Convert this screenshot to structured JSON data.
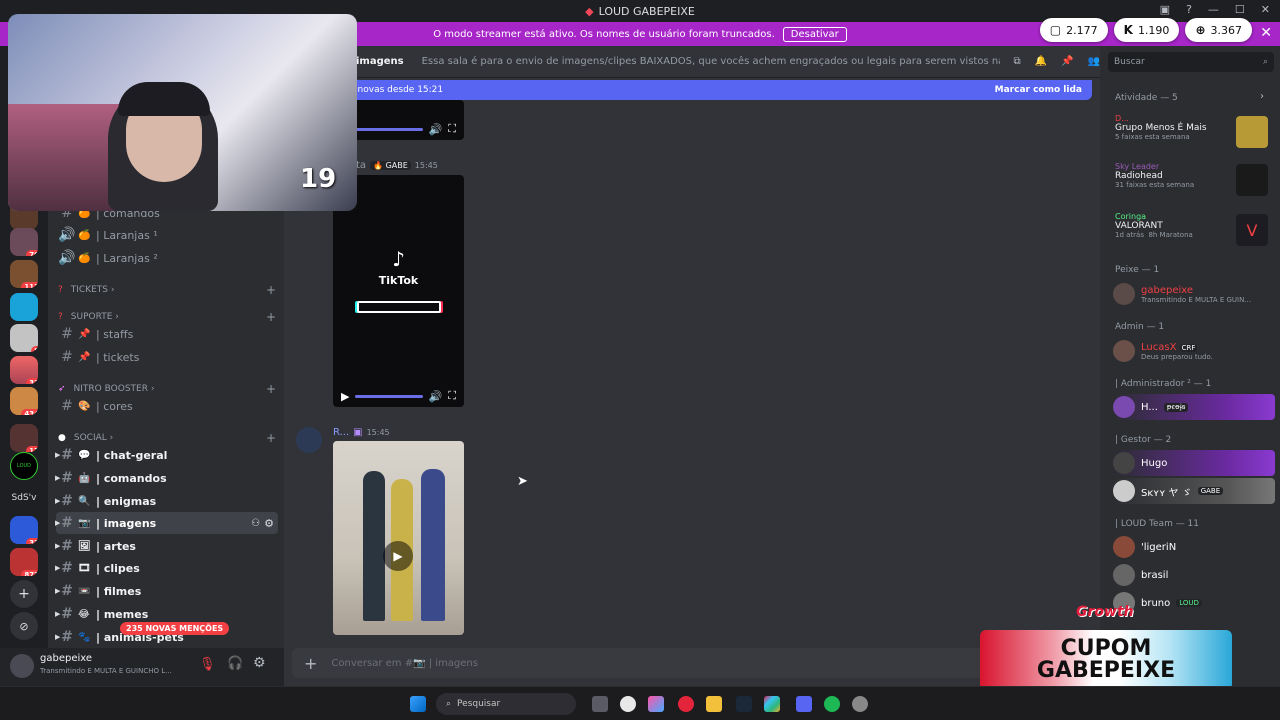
{
  "window": {
    "title": "LOUD GABEPEIXE"
  },
  "banner": {
    "text": "O modo streamer está ativo. Os nomes de usuário foram truncados.",
    "button": "Desativar"
  },
  "pills": [
    {
      "icon": "chat-bubble-icon",
      "value": "2.177"
    },
    {
      "icon": "kick-icon",
      "value": "1.190"
    },
    {
      "icon": "globe-icon",
      "value": "3.367"
    }
  ],
  "webcam": {
    "overlay_number": "19"
  },
  "guild_badges": [
    "70",
    "113",
    "8",
    "32",
    "434",
    "17",
    "32",
    "872"
  ],
  "guild_text": {
    "sdsv": "SdS'v",
    "loud": "LOUD"
  },
  "sidebar": {
    "top_channels": [
      {
        "label": "| comandos",
        "emoji": "🍊",
        "icon": "hash"
      },
      {
        "label": "| Laranjas ¹",
        "emoji": "🍊",
        "icon": "speaker"
      },
      {
        "label": "| Laranjas ²",
        "emoji": "🍊",
        "icon": "speaker"
      }
    ],
    "categories": {
      "tickets": "TICKETS",
      "suporte": "SUPORTE",
      "nitro": "NITRO BOOSTER",
      "social": "SOCIAL"
    },
    "suporte_channels": [
      {
        "label": "| staffs",
        "emoji": "📌"
      },
      {
        "label": "| tickets",
        "emoji": "📌"
      }
    ],
    "nitro_channels": [
      {
        "label": "| cores",
        "emoji": "🎨"
      }
    ],
    "social_channels": [
      {
        "label": "| chat-geral",
        "emoji": "💬"
      },
      {
        "label": "| comandos",
        "emoji": "🤖"
      },
      {
        "label": "| enigmas",
        "emoji": "🔍"
      },
      {
        "label": "| imagens",
        "emoji": "📷"
      },
      {
        "label": "| artes",
        "emoji": "🖼"
      },
      {
        "label": "| clipes",
        "emoji": "🎞"
      },
      {
        "label": "| filmes",
        "emoji": "📼"
      },
      {
        "label": "| memes",
        "emoji": "😂"
      },
      {
        "label": "| animais-pets",
        "emoji": "🐾"
      }
    ],
    "mentions_pill": "235 NOVAS MENÇÕES"
  },
  "user": {
    "name": "gabepeixe",
    "status": "Transmitindo E MULTA E GUINCHO L..."
  },
  "chat": {
    "channel_name": "imagens",
    "topic": "Essa sala é para o envio de imagens/clipes BAIXADOS, que vocês achem engraçados ou legais para serem vistos na live. Serão apagados prints de ou...",
    "new_since": "s novas desde 15:21",
    "mark_read": "Marcar como lida",
    "messages": [
      {
        "author": "ta",
        "tag": "GABE",
        "time": "15:45"
      },
      {
        "author": "R...",
        "time": "15:45"
      }
    ],
    "tiktok_label": "TikTok",
    "input_placeholder": "Conversar em #📷 | imagens"
  },
  "members": {
    "search_placeholder": "Buscar",
    "activity_header": "Atividade — 5",
    "activities": [
      {
        "user": "D...",
        "title": "Grupo Menos É Mais",
        "sub": "5 faixas esta semana"
      },
      {
        "user": "Sky Leader",
        "title": "Radiohead",
        "sub": "31 faixas esta semana"
      },
      {
        "user": "Coringa",
        "title": "VALORANT",
        "sub": "1d atrás",
        "sub2": "8h Maratona"
      }
    ],
    "groups": [
      {
        "header": "Peixe — 1",
        "members": [
          {
            "name": "gabepeixe",
            "sub": "Transmitindo E MULTA E GUIN...",
            "color": "#f23f43"
          }
        ]
      },
      {
        "header": "Admin — 1",
        "members": [
          {
            "name": "LucasX",
            "tag": "CRF",
            "sub": "Deus preparou tudo.",
            "color": "#f23f43"
          }
        ]
      },
      {
        "header": "| Administrador ² — 1",
        "members": [
          {
            "name": "H...",
            "tag": "ᵽꞓꝋɉꞩ",
            "color": "#ffffff"
          }
        ]
      },
      {
        "header": "| Gestor — 2",
        "members": [
          {
            "name": "Hugo",
            "color": "#ffffff"
          },
          {
            "name": "Sĸʏʏ ヤ ゞ",
            "tag": "GABE",
            "color": "#ffffff"
          }
        ]
      },
      {
        "header": "| LOUD Team — 11",
        "members": [
          {
            "name": "'ligeriN",
            "color": "#ffffff"
          },
          {
            "name": "brasil",
            "color": "#ffffff"
          },
          {
            "name": "bruno",
            "tag": "LOUD",
            "color": "#ffffff"
          }
        ]
      }
    ]
  },
  "overlay": {
    "growth": "Growth",
    "cupom_line1": "CUPOM",
    "cupom_line2": "GABEPEIXE"
  },
  "taskbar": {
    "search_placeholder": "Pesquisar"
  }
}
